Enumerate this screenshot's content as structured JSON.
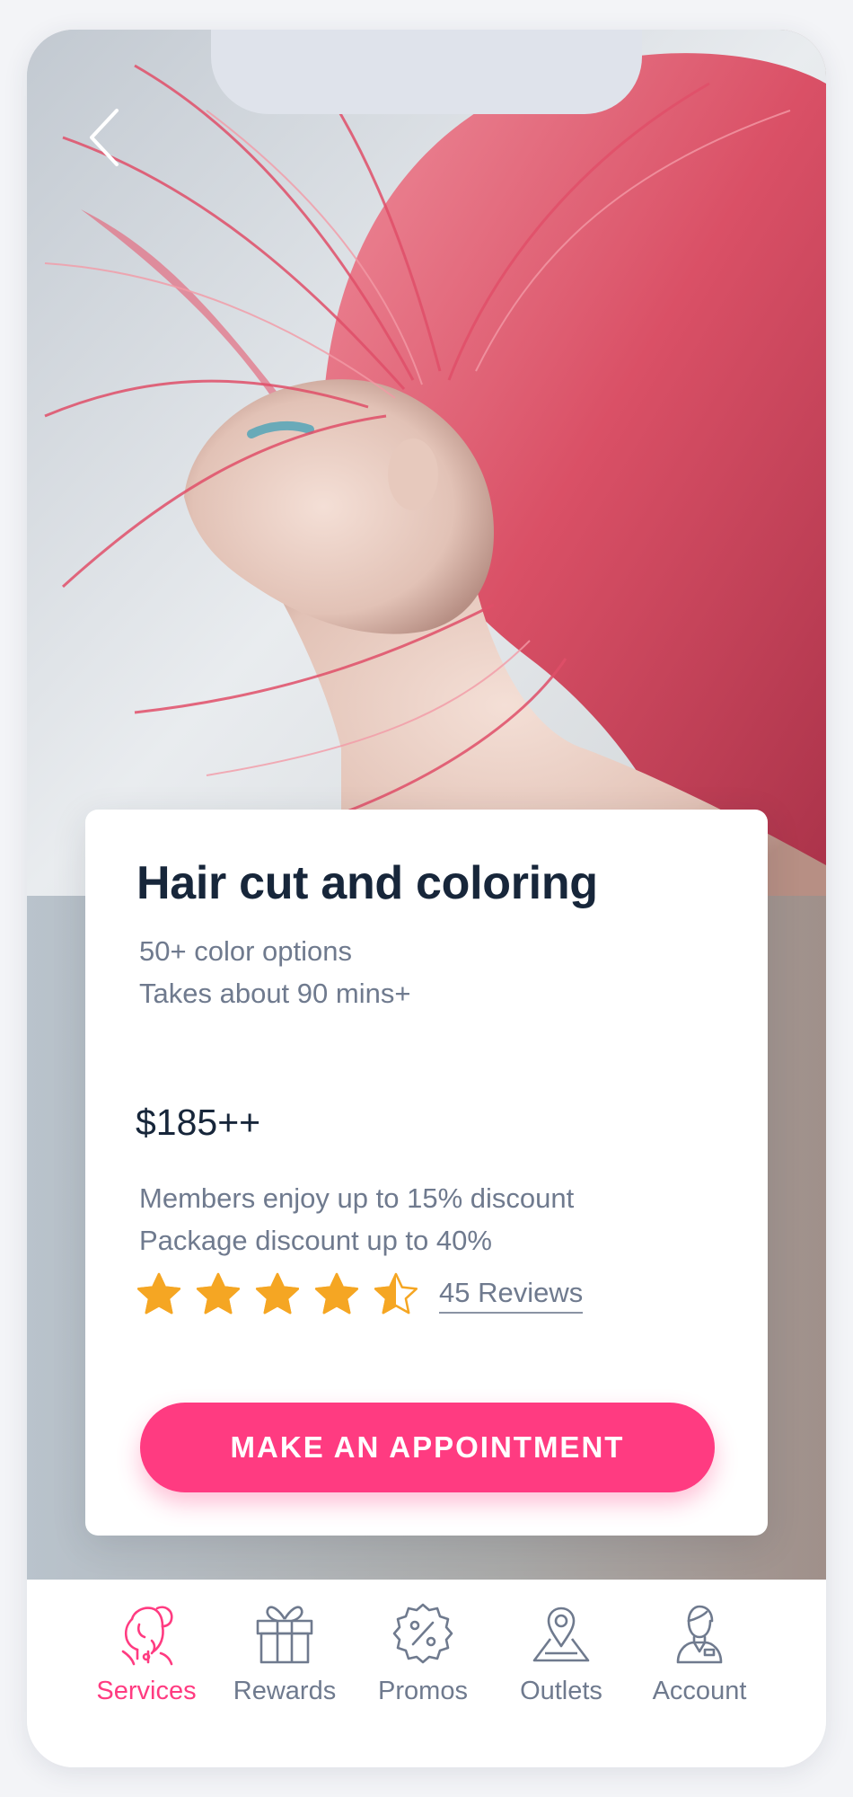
{
  "colors": {
    "accent": "#ff3b81",
    "title_text": "#17263a",
    "secondary_text": "#6f7a8e",
    "star": "#f5a623",
    "hair": "#e0566e"
  },
  "header": {
    "back_icon": "chevron-left-icon"
  },
  "hero": {
    "image": "woman-with-pink-hair-photo"
  },
  "service": {
    "title": "Hair cut and coloring",
    "details": [
      "50+ color options",
      "Takes about 90 mins+"
    ],
    "price": "$185++",
    "discounts": [
      "Members enjoy up to 15% discount",
      "Package discount up to 40%"
    ],
    "rating": 4.5,
    "rating_max": 5,
    "reviews_label": "45 Reviews",
    "cta_label": "MAKE AN APPOINTMENT"
  },
  "tabs": [
    {
      "label": "Services",
      "icon": "hairstyle-icon",
      "active": true
    },
    {
      "label": "Rewards",
      "icon": "gift-icon",
      "active": false
    },
    {
      "label": "Promos",
      "icon": "percent-badge-icon",
      "active": false
    },
    {
      "label": "Outlets",
      "icon": "map-pin-icon",
      "active": false
    },
    {
      "label": "Account",
      "icon": "user-icon",
      "active": false
    }
  ]
}
